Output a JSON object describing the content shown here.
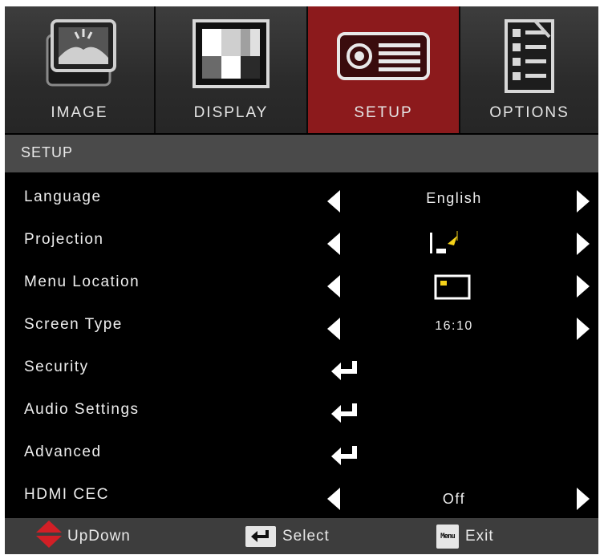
{
  "tabs": [
    {
      "label": "IMAGE",
      "icon": "image-icon",
      "active": false
    },
    {
      "label": "DISPLAY",
      "icon": "display-icon",
      "active": false
    },
    {
      "label": "SETUP",
      "icon": "projector-icon",
      "active": true
    },
    {
      "label": "OPTIONS",
      "icon": "options-checklist-icon",
      "active": false
    }
  ],
  "section": {
    "title": "SETUP"
  },
  "rows": [
    {
      "label": "Language",
      "value": "English",
      "type": "select"
    },
    {
      "label": "Projection",
      "value_icon": "projection-front-desktop-icon",
      "type": "select"
    },
    {
      "label": "Menu Location",
      "value_icon": "menu-location-top-left-icon",
      "type": "select"
    },
    {
      "label": "Screen Type",
      "value": "16:10",
      "type": "select"
    },
    {
      "label": "Security",
      "type": "enter"
    },
    {
      "label": "Audio Settings",
      "type": "enter"
    },
    {
      "label": "Advanced",
      "type": "enter"
    },
    {
      "label": "HDMI CEC",
      "value": "Off",
      "type": "select"
    }
  ],
  "footer": {
    "updown": {
      "label": "UpDown",
      "icon": "up-down-arrows-icon"
    },
    "select": {
      "label": "Select",
      "icon": "enter-key-icon"
    },
    "exit": {
      "label": "Exit",
      "key": "Menu",
      "icon": "menu-key-icon"
    }
  },
  "colors": {
    "active_tab": "#8c1a1c",
    "background": "#000000",
    "section_bar": "#4a4a4a",
    "footer_bar": "#3d3d3d",
    "arrow_red": "#d21f26"
  }
}
